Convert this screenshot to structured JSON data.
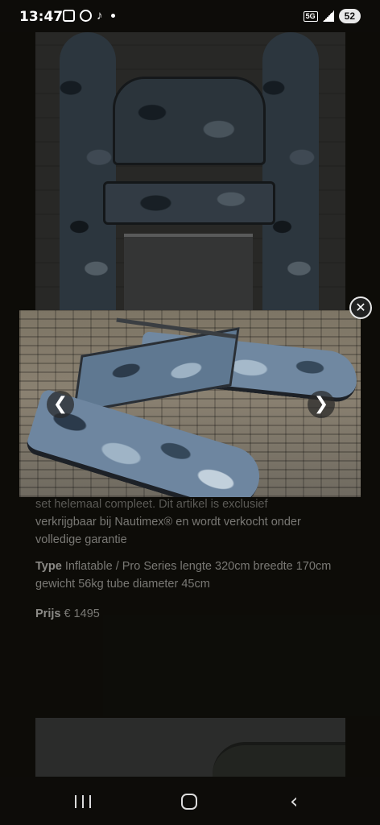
{
  "status_bar": {
    "time": "13:47",
    "network": "5G",
    "battery": "52"
  },
  "page": {
    "description_partial": "set helemaal compleet. Dit artikel is exclusief",
    "description": "verkrijgbaar bij Nautimex® en wordt verkocht onder volledige garantie",
    "specs_label": "Type",
    "specs_text": "Inflatable / Pro Series lengte 320cm breedte 170cm gewicht 56kg tube diameter 45cm",
    "price_label": "Prijs",
    "price_value": "€ 1495"
  },
  "lightbox": {
    "prev_glyph": "❮",
    "next_glyph": "❯",
    "close_glyph": "✕"
  },
  "nav_bar": {
    "back_glyph": "‹"
  },
  "colors": {
    "page_bg": "#17160f",
    "text": "#cfcdc6",
    "camo_base": "#6e86a0"
  },
  "icons": [
    "screenshot-icon",
    "whatsapp-icon",
    "tiktok-icon",
    "signal-icon",
    "battery-icon",
    "chevron-left-icon",
    "chevron-right-icon",
    "close-icon",
    "recents-icon",
    "home-icon",
    "back-icon"
  ]
}
